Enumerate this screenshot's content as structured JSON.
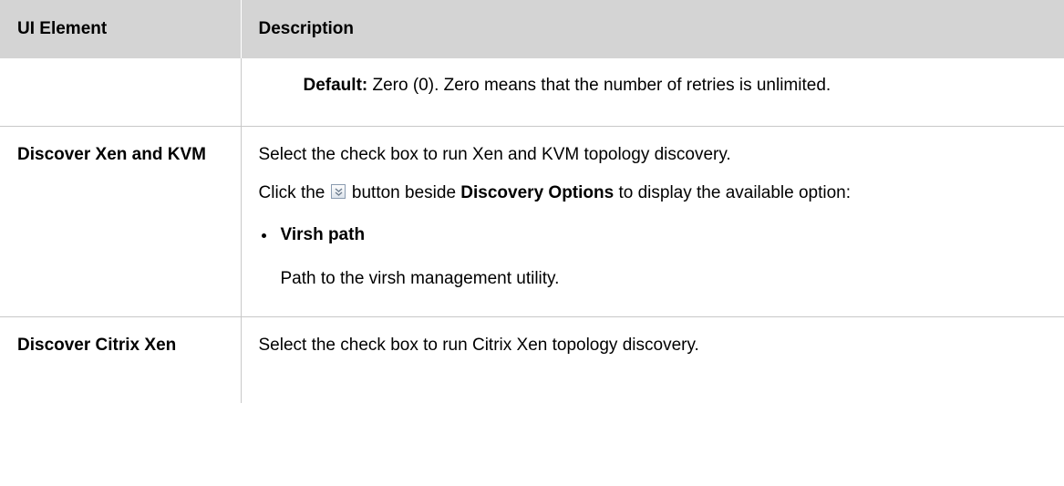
{
  "header": {
    "col1": "UI Element",
    "col2": "Description"
  },
  "rows": [
    {
      "label": "",
      "default_label": "Default:",
      "default_text": " Zero (0). Zero means that the number of retries is unlimited."
    },
    {
      "label": "Discover Xen and KVM",
      "line1": "Select the check box to run Xen and KVM topology discovery.",
      "click_prefix": "Click the ",
      "click_mid": " button beside ",
      "click_bold": "Discovery Options",
      "click_suffix": " to display the available option:",
      "icon": "expand-chevron-icon",
      "option_title": "Virsh path",
      "option_desc": "Path to the virsh management utility."
    },
    {
      "label": "Discover Citrix Xen",
      "line1": "Select the check box to run Citrix Xen topology discovery."
    }
  ]
}
